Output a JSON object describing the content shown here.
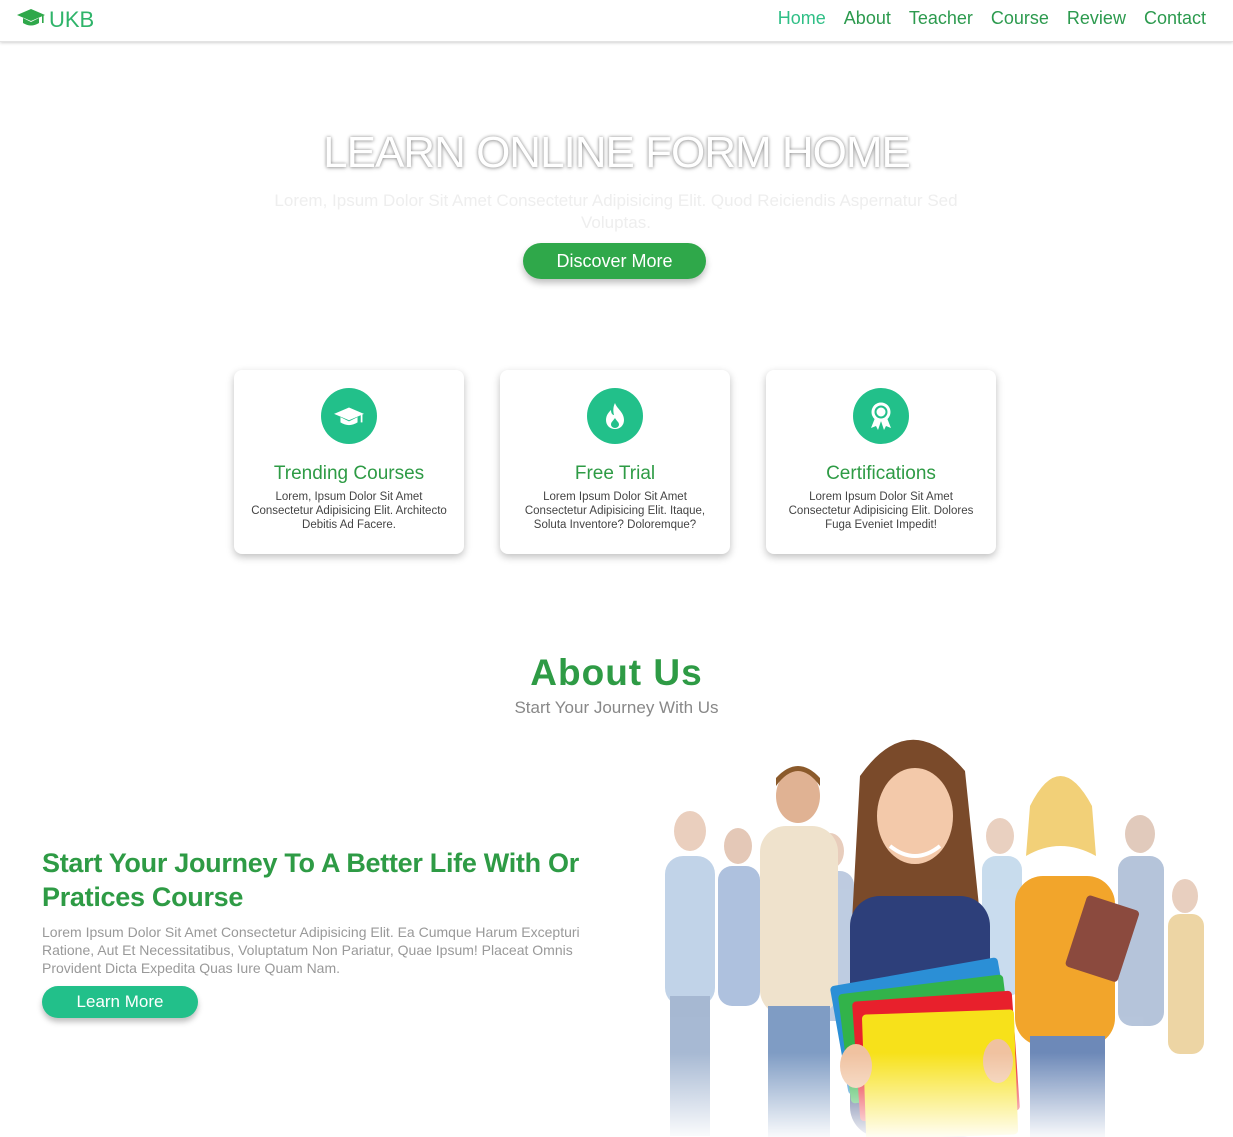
{
  "header": {
    "logo_text": "UKB",
    "logo_icon": "graduation-cap-icon",
    "nav": [
      {
        "label": "Home",
        "active": true
      },
      {
        "label": "About",
        "active": false
      },
      {
        "label": "Teacher",
        "active": false
      },
      {
        "label": "Course",
        "active": false
      },
      {
        "label": "Review",
        "active": false
      },
      {
        "label": "Contact",
        "active": false
      }
    ]
  },
  "hero": {
    "title": "LEARN ONLINE FORM HOME",
    "subtitle": "Lorem, Ipsum Dolor Sit Amet Consectetur Adipisicing Elit. Quod Reiciendis Aspernatur Sed Voluptas.",
    "button": "Discover More"
  },
  "features": [
    {
      "icon": "graduation-cap-icon",
      "title": "Trending Courses",
      "text": "Lorem, Ipsum Dolor Sit Amet Consectetur Adipisicing Elit. Architecto Debitis Ad Facere."
    },
    {
      "icon": "fire-icon",
      "title": "Free Trial",
      "text": "Lorem Ipsum Dolor Sit Amet Consectetur Adipisicing Elit. Itaque, Soluta Inventore? Doloremque?"
    },
    {
      "icon": "award-icon",
      "title": "Certifications",
      "text": "Lorem Ipsum Dolor Sit Amet Consectetur Adipisicing Elit. Dolores Fuga Eveniet Impedit!"
    }
  ],
  "about": {
    "title": "About Us",
    "subtitle": "Start Your Journey With Us",
    "heading": "Start Your Journey To A Better Life With Or Pratices Course",
    "text": "Lorem Ipsum Dolor Sit Amet Consectetur Adipisicing Elit. Ea Cumque Harum Excepturi Ratione, Aut Et Necessitatibus, Voluptatum Non Pariatur, Quae Ipsum! Placeat Omnis Provident Dicta Expedita Quas Iure Quam Nam.",
    "button": "Learn More"
  },
  "colors": {
    "brand_green": "#2e9b45",
    "accent_teal": "#22c08a",
    "nav_active": "#2fbf86"
  }
}
